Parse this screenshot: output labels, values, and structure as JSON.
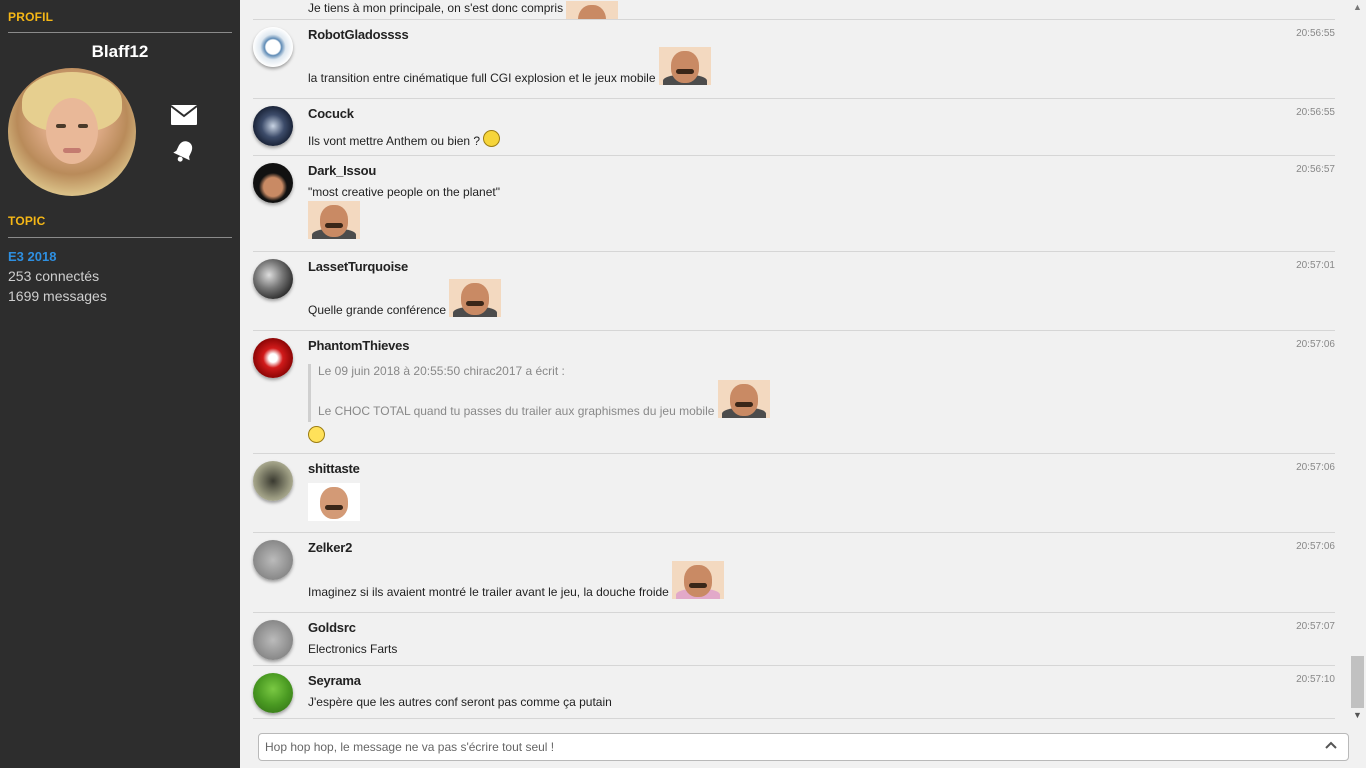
{
  "sidebar": {
    "profile_title": "PROFIL",
    "username": "Blaff12",
    "topic_title": "TOPIC",
    "topic_name": "E3 2018",
    "connected": "253 connectés",
    "messages": "1699 messages"
  },
  "chat": {
    "top_partial": "Je tiens à mon principale, on s'est donc compris",
    "messages": [
      {
        "user": "RobotGladossss",
        "time": "20:56:55",
        "text": "la transition entre cinématique full CGI explosion et le jeux mobile"
      },
      {
        "user": "Cocuck",
        "time": "20:56:55",
        "text": "Ils vont mettre Anthem ou bien ?"
      },
      {
        "user": "Dark_Issou",
        "time": "20:56:57",
        "text": "\"most creative people on the planet\""
      },
      {
        "user": "LassetTurquoise",
        "time": "20:57:01",
        "text": "Quelle grande conférence"
      },
      {
        "user": "PhantomThieves",
        "time": "20:57:06",
        "quote_header": "Le 09 juin 2018 à 20:55:50 chirac2017 a écrit :",
        "quote_text": "Le CHOC TOTAL quand tu passes du trailer aux graphismes du jeu mobile"
      },
      {
        "user": "shittaste",
        "time": "20:57:06"
      },
      {
        "user": "Zelker2",
        "time": "20:57:06",
        "text": "Imaginez si ils avaient montré le trailer avant le jeu, la douche froide"
      },
      {
        "user": "Goldsrc",
        "time": "20:57:07",
        "text": "Electronics Farts"
      },
      {
        "user": "Seyrama",
        "time": "20:57:10",
        "text": "J'espère que les autres conf seront pas comme ça putain"
      }
    ]
  },
  "input": {
    "placeholder": "Hop hop hop, le message ne va pas s'écrire tout seul !"
  }
}
